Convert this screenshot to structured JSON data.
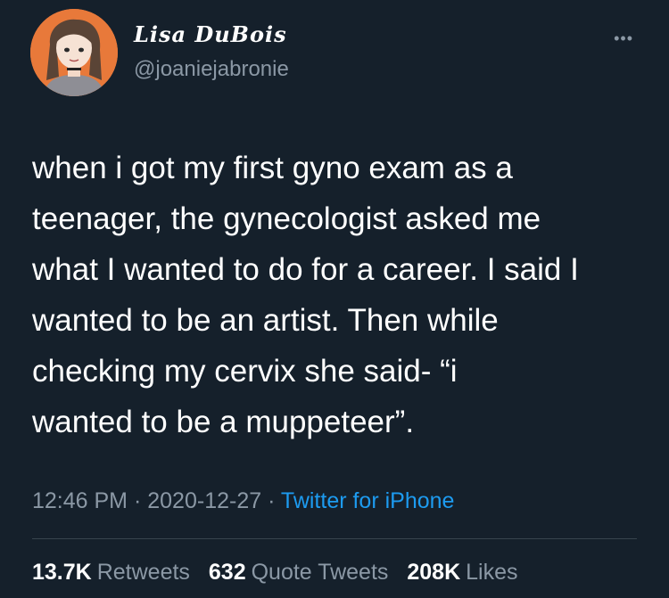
{
  "user": {
    "display_name": "Lisa DuBois",
    "handle": "@joaniejabronie"
  },
  "more_icon": "more-horizontal-icon",
  "tweet": {
    "lines": [
      "when i got my first gyno exam as a",
      "teenager, the gynecologist asked me",
      "what I wanted to do for a career. I said I",
      "wanted to be an artist. Then while",
      "checking my cervix she said- “i",
      "wanted to be a muppeteer”."
    ]
  },
  "meta": {
    "time": "12:46 PM",
    "date": "2020-12-27",
    "source": "Twitter for iPhone"
  },
  "stats": {
    "retweets_count": "13.7K",
    "retweets_label": "Retweets",
    "quotes_count": "632",
    "quotes_label": "Quote Tweets",
    "likes_count": "208K",
    "likes_label": "Likes"
  },
  "colors": {
    "background": "#15202b",
    "muted": "#8b98a5",
    "link": "#1d9bf0",
    "avatar_bg": "#e8793a"
  }
}
